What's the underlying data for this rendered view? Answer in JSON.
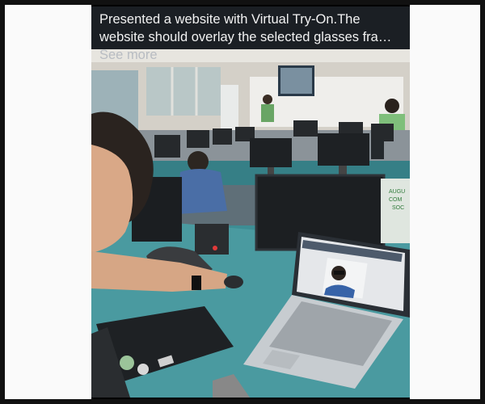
{
  "post": {
    "caption_text": "Presented a website with Virtual Try-On.The website should overlay the selected glasses fra…",
    "see_more_label": "See more"
  },
  "photo": {
    "description_icon": "classroom-photo",
    "colors": {
      "wall": "#d9d6cf",
      "ceiling": "#e8e6e1",
      "desk": "#3f8c93",
      "monitor": "#1f2326",
      "laptop": "#c9cdd1",
      "shirt_green": "#7ec17a",
      "shirt_blue": "#4a6da5",
      "chair": "#3f4449"
    },
    "sign_text": "AUGU\nCOM\nSOC"
  }
}
